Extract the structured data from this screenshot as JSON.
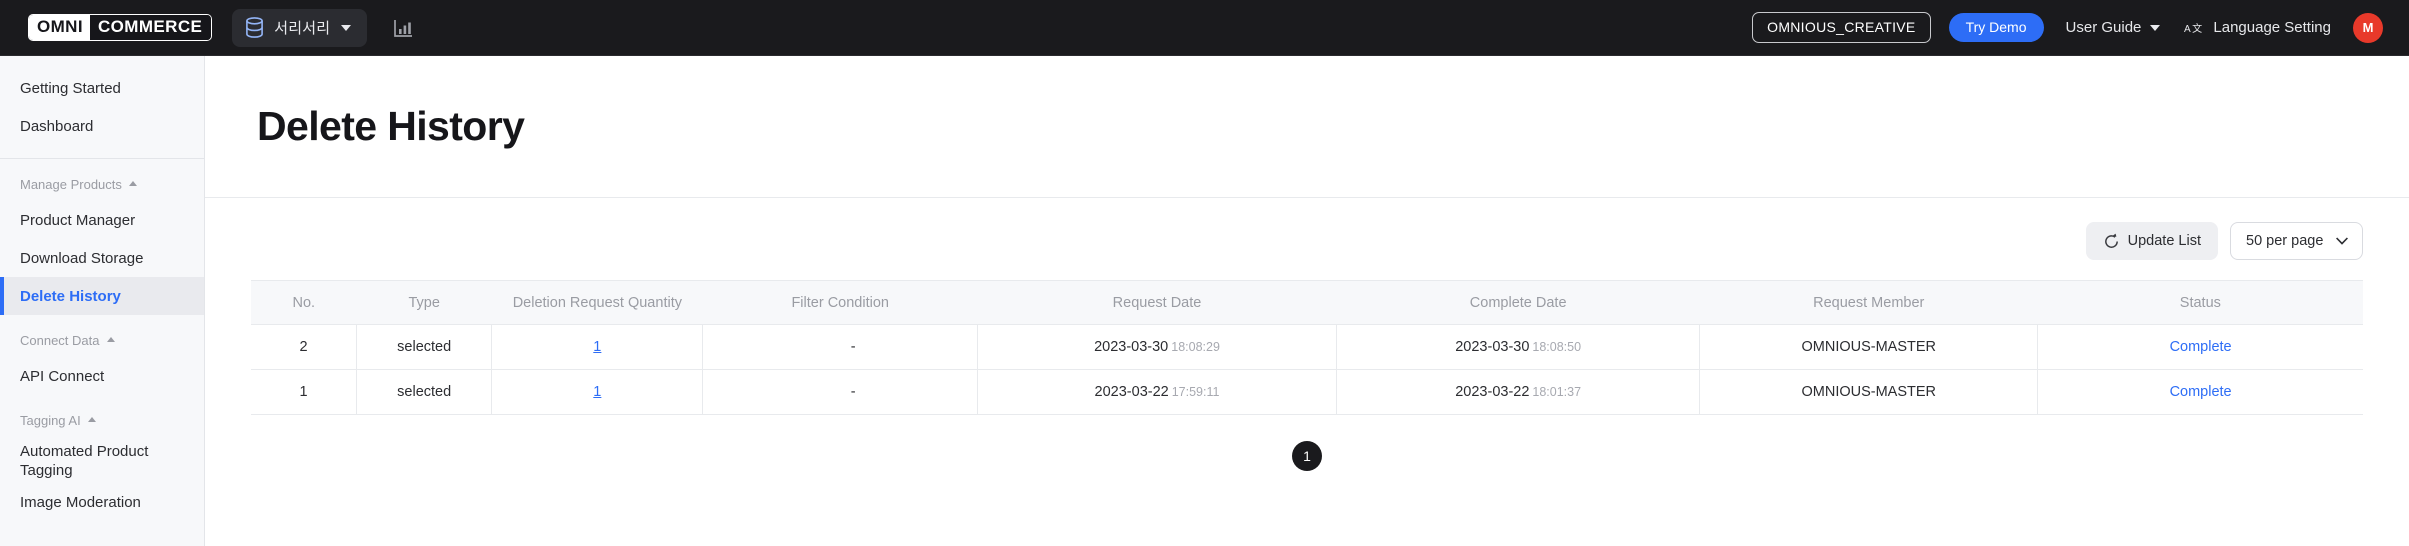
{
  "topbar": {
    "logo_left": "OMNI",
    "logo_right": "COMMERCE",
    "workspace_name": "서리서리",
    "workspace_icon": "database-icon",
    "analytics_icon": "bar-chart-icon",
    "account_chip": "OMNIOUS_CREATIVE",
    "try_demo": "Try Demo",
    "user_guide": "User Guide",
    "language_setting": "Language Setting",
    "language_icon": "translate-icon",
    "avatar_initial": "M",
    "avatar_color": "#e8392a",
    "accent_color": "#2d6df6",
    "bar_color": "#1a1a1d"
  },
  "sidebar": {
    "items": [
      {
        "label": "Getting Started",
        "type": "link",
        "active": false
      },
      {
        "label": "Dashboard",
        "type": "link",
        "active": false
      },
      {
        "label": "Manage Products",
        "type": "group"
      },
      {
        "label": "Product Manager",
        "type": "link",
        "active": false
      },
      {
        "label": "Download Storage",
        "type": "link",
        "active": false
      },
      {
        "label": "Delete History",
        "type": "link",
        "active": true
      },
      {
        "label": "Connect Data",
        "type": "group"
      },
      {
        "label": "API Connect",
        "type": "link",
        "active": false
      },
      {
        "label": "Tagging AI",
        "type": "group"
      },
      {
        "label": "Automated Product Tagging",
        "type": "link",
        "active": false
      },
      {
        "label": "Image Moderation",
        "type": "link",
        "active": false
      }
    ]
  },
  "main": {
    "page_title": "Delete History",
    "toolbar": {
      "update_list": "Update List",
      "refresh_icon": "refresh-icon",
      "per_page": "50 per page",
      "dropdown_icon": "chevron-down-icon"
    },
    "table": {
      "columns": [
        "No.",
        "Type",
        "Deletion Request Quantity",
        "Filter Condition",
        "Request Date",
        "Complete Date",
        "Request Member",
        "Status"
      ],
      "rows": [
        {
          "no": "2",
          "type": "selected",
          "quantity": "1",
          "filter_condition": "-",
          "request_date": "2023-03-30",
          "request_time": "18:08:29",
          "complete_date": "2023-03-30",
          "complete_time": "18:08:50",
          "request_member": "OMNIOUS-MASTER",
          "status": "Complete"
        },
        {
          "no": "1",
          "type": "selected",
          "quantity": "1",
          "filter_condition": "-",
          "request_date": "2023-03-22",
          "request_time": "17:59:11",
          "complete_date": "2023-03-22",
          "complete_time": "18:01:37",
          "request_member": "OMNIOUS-MASTER",
          "status": "Complete"
        }
      ]
    },
    "pagination": {
      "current_page": "1"
    }
  }
}
